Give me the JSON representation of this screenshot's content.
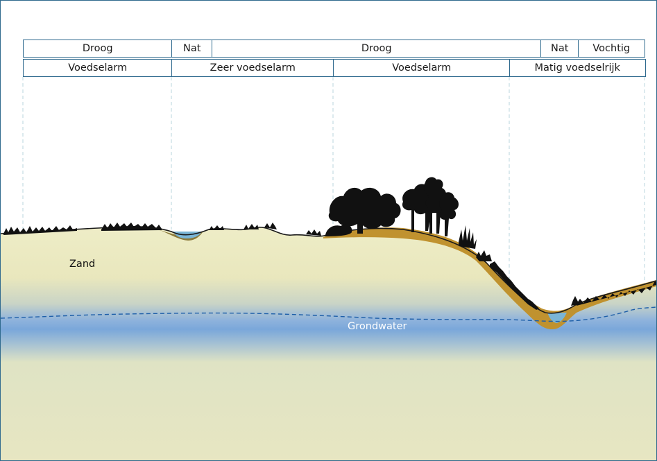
{
  "moisture_row": [
    {
      "label": "Droog"
    },
    {
      "label": "Nat"
    },
    {
      "label": "Droog"
    },
    {
      "label": "Nat"
    },
    {
      "label": "Vochtig"
    }
  ],
  "nutrient_row": [
    {
      "label": "Voedselarm"
    },
    {
      "label": "Zeer voedselarm"
    },
    {
      "label": "Voedselarm"
    },
    {
      "label": "Matig voedselrijk"
    }
  ],
  "labels": {
    "sand": "Zand",
    "groundwater": "Grondwater"
  },
  "colors": {
    "frame": "#2f6a8e",
    "sand": "#ecebc2",
    "groundwater": "#6d9ed6",
    "humus": "#c0922f",
    "pool_water": "#7ab5d6",
    "vegetation": "#111111"
  }
}
